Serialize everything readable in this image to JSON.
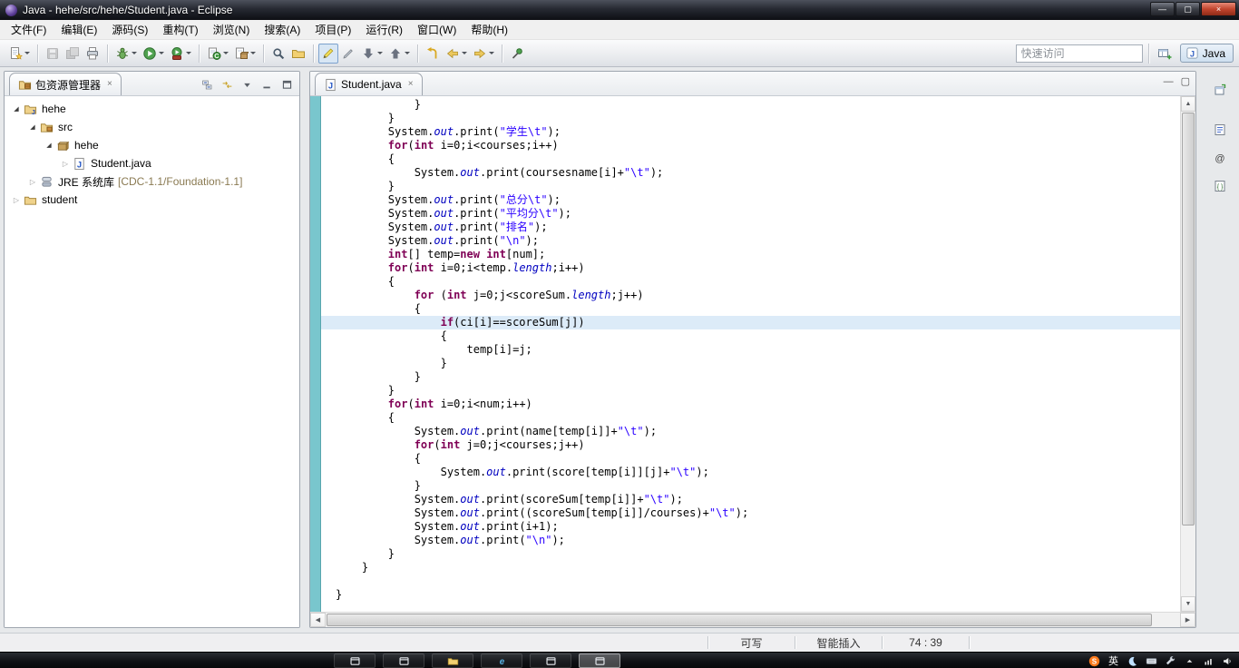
{
  "window": {
    "title": "Java - hehe/src/hehe/Student.java -  Eclipse",
    "controls": [
      {
        "id": "minimize",
        "glyph": "—"
      },
      {
        "id": "restore",
        "glyph": "▢"
      },
      {
        "id": "close",
        "glyph": "×"
      }
    ]
  },
  "menubar": {
    "items": [
      {
        "id": "file",
        "label": "文件(F)"
      },
      {
        "id": "edit",
        "label": "编辑(E)"
      },
      {
        "id": "source",
        "label": "源码(S)"
      },
      {
        "id": "refactor",
        "label": "重构(T)"
      },
      {
        "id": "navigate",
        "label": "浏览(N)"
      },
      {
        "id": "search",
        "label": "搜索(A)"
      },
      {
        "id": "project",
        "label": "项目(P)"
      },
      {
        "id": "run",
        "label": "运行(R)"
      },
      {
        "id": "window",
        "label": "窗口(W)"
      },
      {
        "id": "help",
        "label": "帮助(H)"
      }
    ]
  },
  "toolbar": {
    "quick_access_placeholder": "快速访问",
    "perspective_label": "Java",
    "groups": [
      [
        {
          "name": "new-wizard",
          "dropdown": true
        }
      ],
      [
        {
          "name": "save",
          "disabled": true
        },
        {
          "name": "save-all",
          "disabled": true
        },
        {
          "name": "print"
        }
      ],
      [
        {
          "name": "debug",
          "dropdown": true
        },
        {
          "name": "run",
          "dropdown": true
        },
        {
          "name": "external-tools",
          "dropdown": true
        }
      ],
      [
        {
          "name": "new-java-class",
          "dropdown": true
        },
        {
          "name": "new-java-package",
          "dropdown": true
        }
      ],
      [
        {
          "name": "search"
        },
        {
          "name": "open-folder"
        }
      ],
      [
        {
          "name": "mark-occurrences",
          "active": true
        },
        {
          "name": "annotations"
        },
        {
          "name": "next-annotation",
          "dropdown": true
        },
        {
          "name": "prev-annotation",
          "dropdown": true
        }
      ],
      [
        {
          "name": "last-edit"
        },
        {
          "name": "back",
          "dropdown": true
        },
        {
          "name": "forward",
          "dropdown": true
        }
      ],
      [
        {
          "name": "pin-editor"
        }
      ]
    ]
  },
  "explorer": {
    "tab_title": "包资源管理器",
    "tab_close": "×",
    "toolbar": [
      "collapse-all",
      "link-editor",
      "view-menu",
      "min-view",
      "max-view"
    ],
    "tree": [
      {
        "id": "project-hehe",
        "label": "hehe",
        "icon": "java-project",
        "depth": 0,
        "state": "expanded"
      },
      {
        "id": "folder-src",
        "label": "src",
        "icon": "source-folder",
        "depth": 1,
        "state": "expanded"
      },
      {
        "id": "package-hehe",
        "label": "hehe",
        "icon": "package",
        "depth": 2,
        "state": "expanded"
      },
      {
        "id": "file-student-java",
        "label": "Student.java",
        "icon": "java-file",
        "depth": 3,
        "state": "collapsed"
      },
      {
        "id": "jre-system-library",
        "label": "JRE 系统库",
        "suffix": "[CDC-1.1/Foundation-1.1]",
        "icon": "library",
        "depth": 1,
        "state": "collapsed"
      },
      {
        "id": "project-student",
        "label": "student",
        "icon": "project-closed",
        "depth": 0,
        "state": "collapsed"
      }
    ]
  },
  "editor": {
    "tab": {
      "title": "Student.java",
      "icon": "java-file",
      "close": "×"
    },
    "minimize_glyph": "—",
    "maximize_glyph": "▢",
    "code": {
      "current_line_index": 16,
      "lines": [
        [
          [
            "p",
            "            }"
          ]
        ],
        [
          [
            "p",
            "        }"
          ]
        ],
        [
          [
            "p",
            "        System."
          ],
          [
            "f",
            "out"
          ],
          [
            "p",
            ".print("
          ],
          [
            "s",
            "\"学生\\t\""
          ],
          [
            "p",
            ");"
          ]
        ],
        [
          [
            "p",
            "        "
          ],
          [
            "k",
            "for"
          ],
          [
            "p",
            "("
          ],
          [
            "k",
            "int"
          ],
          [
            "p",
            " i=0;i<courses;i++)"
          ]
        ],
        [
          [
            "p",
            "        {"
          ]
        ],
        [
          [
            "p",
            "            System."
          ],
          [
            "f",
            "out"
          ],
          [
            "p",
            ".print(coursesname[i]+"
          ],
          [
            "s",
            "\"\\t\""
          ],
          [
            "p",
            ");"
          ]
        ],
        [
          [
            "p",
            "        }"
          ]
        ],
        [
          [
            "p",
            "        System."
          ],
          [
            "f",
            "out"
          ],
          [
            "p",
            ".print("
          ],
          [
            "s",
            "\"总分\\t\""
          ],
          [
            "p",
            ");"
          ]
        ],
        [
          [
            "p",
            "        System."
          ],
          [
            "f",
            "out"
          ],
          [
            "p",
            ".print("
          ],
          [
            "s",
            "\"平均分\\t\""
          ],
          [
            "p",
            ");"
          ]
        ],
        [
          [
            "p",
            "        System."
          ],
          [
            "f",
            "out"
          ],
          [
            "p",
            ".print("
          ],
          [
            "s",
            "\"排名\""
          ],
          [
            "p",
            ");"
          ]
        ],
        [
          [
            "p",
            "        System."
          ],
          [
            "f",
            "out"
          ],
          [
            "p",
            ".print("
          ],
          [
            "s",
            "\"\\n\""
          ],
          [
            "p",
            ");"
          ]
        ],
        [
          [
            "p",
            "        "
          ],
          [
            "k",
            "int"
          ],
          [
            "p",
            "[] temp="
          ],
          [
            "k",
            "new"
          ],
          [
            "p",
            " "
          ],
          [
            "k",
            "int"
          ],
          [
            "p",
            "[num];"
          ]
        ],
        [
          [
            "p",
            "        "
          ],
          [
            "k",
            "for"
          ],
          [
            "p",
            "("
          ],
          [
            "k",
            "int"
          ],
          [
            "p",
            " i=0;i<temp."
          ],
          [
            "f",
            "length"
          ],
          [
            "p",
            ";i++)"
          ]
        ],
        [
          [
            "p",
            "        {"
          ]
        ],
        [
          [
            "p",
            "            "
          ],
          [
            "k",
            "for"
          ],
          [
            "p",
            " ("
          ],
          [
            "k",
            "int"
          ],
          [
            "p",
            " j=0;j<scoreSum."
          ],
          [
            "f",
            "length"
          ],
          [
            "p",
            ";j++)"
          ]
        ],
        [
          [
            "p",
            "            {"
          ]
        ],
        [
          [
            "p",
            "                "
          ],
          [
            "k",
            "if"
          ],
          [
            "p",
            "(ci[i]==scoreSum[j])"
          ]
        ],
        [
          [
            "p",
            "                {"
          ]
        ],
        [
          [
            "p",
            "                    temp[i]=j;"
          ]
        ],
        [
          [
            "p",
            "                }"
          ]
        ],
        [
          [
            "p",
            "            }"
          ]
        ],
        [
          [
            "p",
            "        }"
          ]
        ],
        [
          [
            "p",
            "        "
          ],
          [
            "k",
            "for"
          ],
          [
            "p",
            "("
          ],
          [
            "k",
            "int"
          ],
          [
            "p",
            " i=0;i<num;i++)"
          ]
        ],
        [
          [
            "p",
            "        {"
          ]
        ],
        [
          [
            "p",
            "            System."
          ],
          [
            "f",
            "out"
          ],
          [
            "p",
            ".print(name[temp[i]]+"
          ],
          [
            "s",
            "\"\\t\""
          ],
          [
            "p",
            ");"
          ]
        ],
        [
          [
            "p",
            "            "
          ],
          [
            "k",
            "for"
          ],
          [
            "p",
            "("
          ],
          [
            "k",
            "int"
          ],
          [
            "p",
            " j=0;j<courses;j++)"
          ]
        ],
        [
          [
            "p",
            "            {"
          ]
        ],
        [
          [
            "p",
            "                System."
          ],
          [
            "f",
            "out"
          ],
          [
            "p",
            ".print(score[temp[i]][j]+"
          ],
          [
            "s",
            "\"\\t\""
          ],
          [
            "p",
            ");"
          ]
        ],
        [
          [
            "p",
            "            }"
          ]
        ],
        [
          [
            "p",
            "            System."
          ],
          [
            "f",
            "out"
          ],
          [
            "p",
            ".print(scoreSum[temp[i]]+"
          ],
          [
            "s",
            "\"\\t\""
          ],
          [
            "p",
            ");"
          ]
        ],
        [
          [
            "p",
            "            System."
          ],
          [
            "f",
            "out"
          ],
          [
            "p",
            ".print((scoreSum[temp[i]]/courses)+"
          ],
          [
            "s",
            "\"\\t\""
          ],
          [
            "p",
            ");"
          ]
        ],
        [
          [
            "p",
            "            System."
          ],
          [
            "f",
            "out"
          ],
          [
            "p",
            ".print(i+1);"
          ]
        ],
        [
          [
            "p",
            "            System."
          ],
          [
            "f",
            "out"
          ],
          [
            "p",
            ".print("
          ],
          [
            "s",
            "\"\\n\""
          ],
          [
            "p",
            ");"
          ]
        ],
        [
          [
            "p",
            "        }"
          ]
        ],
        [
          [
            "p",
            "    }"
          ]
        ],
        [
          [
            "p",
            ""
          ]
        ],
        [
          [
            "p",
            "}"
          ]
        ]
      ]
    }
  },
  "right_bar": {
    "icons": [
      {
        "id": "restore-views",
        "icon": "restore-view"
      },
      {
        "id": "task-list-view",
        "icon": "task-list"
      },
      {
        "id": "javadoc-view",
        "icon": "javadoc"
      },
      {
        "id": "declaration-view",
        "icon": "declaration"
      }
    ]
  },
  "statusbar": {
    "items": [
      {
        "id": "write-mode",
        "text": "可写"
      },
      {
        "id": "insert-mode",
        "text": "智能插入"
      },
      {
        "id": "caret-position",
        "text": "74 : 39"
      }
    ]
  },
  "taskbar": {
    "apps": [
      {
        "id": "app-window-1",
        "icon": "window"
      },
      {
        "id": "app-window-2",
        "icon": "window"
      },
      {
        "id": "app-explorer",
        "icon": "folder"
      },
      {
        "id": "app-ie",
        "icon": "ie"
      },
      {
        "id": "app-window-3",
        "icon": "window"
      },
      {
        "id": "app-eclipse",
        "icon": "window",
        "active": true
      }
    ],
    "tray": [
      {
        "id": "sogou-ime",
        "icon": "sogou"
      },
      {
        "id": "ime-language",
        "text": "英"
      },
      {
        "id": "ime-mode-moon",
        "icon": "moon"
      },
      {
        "id": "ime-keyboard",
        "icon": "keyboard"
      },
      {
        "id": "ime-toolbox",
        "icon": "wrench"
      },
      {
        "id": "tray-show-hidden",
        "icon": "up-arrow"
      },
      {
        "id": "network-status",
        "icon": "network"
      },
      {
        "id": "volume",
        "icon": "volume"
      }
    ]
  }
}
